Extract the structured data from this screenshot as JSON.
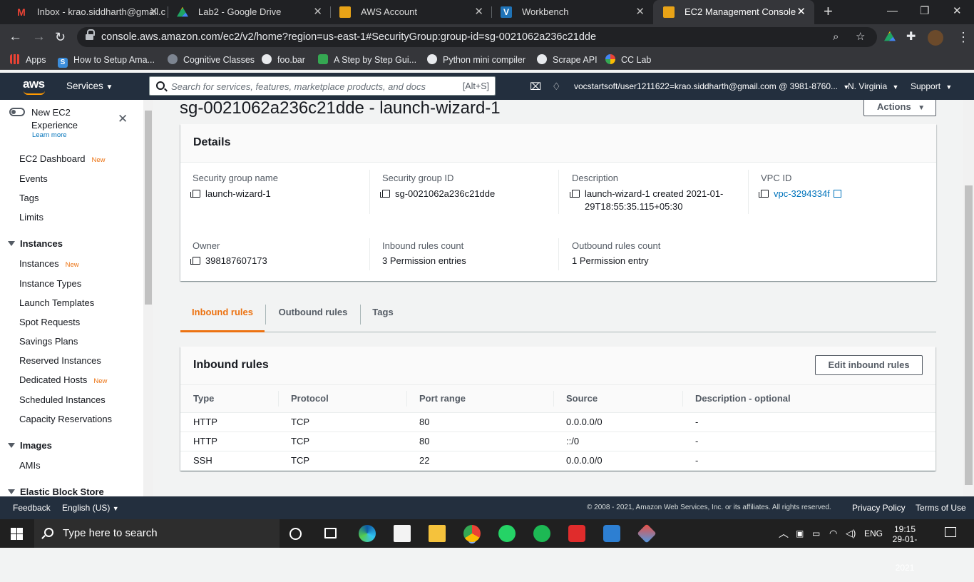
{
  "browser": {
    "tabs": [
      {
        "title": "Inbox - krao.siddharth@gmail.c",
        "icon": "gmail-icon",
        "color": "#ea4335"
      },
      {
        "title": "Lab2 - Google Drive",
        "icon": "drive-icon",
        "color": "#1fa463"
      },
      {
        "title": "AWS Account",
        "icon": "aws-box-icon",
        "color": "#e8a317"
      },
      {
        "title": "Workbench",
        "icon": "vocareum-icon",
        "color": "#1f73b7"
      },
      {
        "title": "EC2 Management Console",
        "icon": "aws-box-icon",
        "color": "#e8a317"
      }
    ],
    "url": "console.aws.amazon.com/ec2/v2/home?region=us-east-1#SecurityGroup:group-id=sg-0021062a236c21dde",
    "bookmarks": [
      {
        "label": "Apps",
        "icon": "apps-grid-icon",
        "color": "#ea4335"
      },
      {
        "label": "How to Setup Ama...",
        "icon": "s-icon",
        "color": "#3b8ddb"
      },
      {
        "label": "Cognitive Classes",
        "icon": "cognitive-icon",
        "color": "#7d8591"
      },
      {
        "label": "foo.bar",
        "icon": "globe-icon",
        "color": "#e8eaed"
      },
      {
        "label": "A Step by Step Gui...",
        "icon": "dg-icon",
        "color": "#35a852"
      },
      {
        "label": "Python mini compiler",
        "icon": "github-icon",
        "color": "#e8eaed"
      },
      {
        "label": "Scrape API",
        "icon": "globe-icon",
        "color": "#e8eaed"
      },
      {
        "label": "CC Lab",
        "icon": "google-icon",
        "color": "#4285f4"
      }
    ]
  },
  "aws": {
    "logo": "aws",
    "services": "Services",
    "search_placeholder": "Search for services, features, marketplace products, and docs",
    "search_hint": "[Alt+S]",
    "account": "vocstartsoft/user1211622=krao.siddharth@gmail.com @ 3981-8760...",
    "region": "N. Virginia",
    "support": "Support"
  },
  "sidebar": {
    "new_exp_title": "New EC2",
    "new_exp_title2": "Experience",
    "learn_more": "Learn more",
    "new_badge": "New",
    "items_top": [
      "EC2 Dashboard",
      "Events",
      "Tags",
      "Limits"
    ],
    "instances_header": "Instances",
    "instances_items": [
      "Instances",
      "Instance Types",
      "Launch Templates",
      "Spot Requests",
      "Savings Plans",
      "Reserved Instances",
      "Dedicated Hosts",
      "Scheduled Instances",
      "Capacity Reservations"
    ],
    "images_header": "Images",
    "images_items": [
      "AMIs"
    ],
    "ebs_header": "Elastic Block Store"
  },
  "page": {
    "title": "sg-0021062a236c21dde - launch-wizard-1",
    "actions": "Actions",
    "details_title": "Details",
    "sg_name_label": "Security group name",
    "sg_name": "launch-wizard-1",
    "sg_id_label": "Security group ID",
    "sg_id": "sg-0021062a236c21dde",
    "desc_label": "Description",
    "desc": "launch-wizard-1 created 2021-01-29T18:55:35.115+05:30",
    "vpc_label": "VPC ID",
    "vpc": "vpc-3294334f",
    "owner_label": "Owner",
    "owner": "398187607173",
    "inbound_count_label": "Inbound rules count",
    "inbound_count": "3 Permission entries",
    "outbound_count_label": "Outbound rules count",
    "outbound_count": "1 Permission entry",
    "tabs": [
      "Inbound rules",
      "Outbound rules",
      "Tags"
    ],
    "rules_title": "Inbound rules",
    "edit_button": "Edit inbound rules",
    "columns": [
      "Type",
      "Protocol",
      "Port range",
      "Source",
      "Description - optional"
    ],
    "rows": [
      [
        "HTTP",
        "TCP",
        "80",
        "0.0.0.0/0",
        "-"
      ],
      [
        "HTTP",
        "TCP",
        "80",
        "::/0",
        "-"
      ],
      [
        "SSH",
        "TCP",
        "22",
        "0.0.0.0/0",
        "-"
      ]
    ]
  },
  "footer": {
    "feedback": "Feedback",
    "language": "English (US)",
    "copyright": "© 2008 - 2021, Amazon Web Services, Inc. or its affiliates. All rights reserved.",
    "privacy": "Privacy Policy",
    "terms": "Terms of Use"
  },
  "taskbar": {
    "search_placeholder": "Type here to search",
    "lang": "ENG",
    "time": "19:15",
    "date": "29-01-2021"
  },
  "colors": {
    "accent": "#ec7211",
    "link": "#0073bb",
    "aws_nav": "#232f3e"
  }
}
